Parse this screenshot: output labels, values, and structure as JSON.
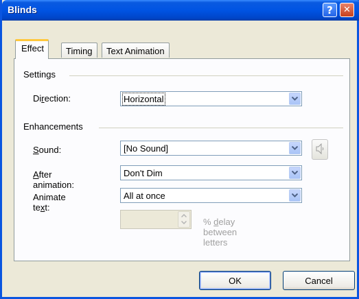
{
  "window": {
    "title": "Blinds"
  },
  "titlebar_buttons": {
    "help_glyph": "?",
    "close_glyph": "✕"
  },
  "tabs": [
    {
      "label": "Effect",
      "active": true
    },
    {
      "label": "Timing",
      "active": false
    },
    {
      "label": "Text Animation",
      "active": false
    }
  ],
  "settings": {
    "group_label": "Settings",
    "direction": {
      "label_pre": "Di",
      "label_key": "r",
      "label_post": "ection:",
      "value": "Horizontal"
    }
  },
  "enhancements": {
    "group_label": "Enhancements",
    "sound": {
      "label_pre": "",
      "label_key": "S",
      "label_post": "ound:",
      "value": "[No Sound]",
      "icon": "speaker-icon"
    },
    "after_animation": {
      "label_pre": "",
      "label_key": "A",
      "label_post": "fter animation:",
      "value": "Don't Dim"
    },
    "animate_text": {
      "label_pre": "Animate te",
      "label_key": "x",
      "label_post": "t:",
      "value": "All at once"
    },
    "delay": {
      "value": "",
      "label_pre": "% ",
      "label_key": "d",
      "label_post": "elay between letters"
    }
  },
  "buttons": {
    "ok": "OK",
    "cancel": "Cancel"
  },
  "colors": {
    "titlebar": "#0054e3",
    "tab_highlight": "#ffc83c",
    "dialog_bg": "#ece9d8"
  }
}
